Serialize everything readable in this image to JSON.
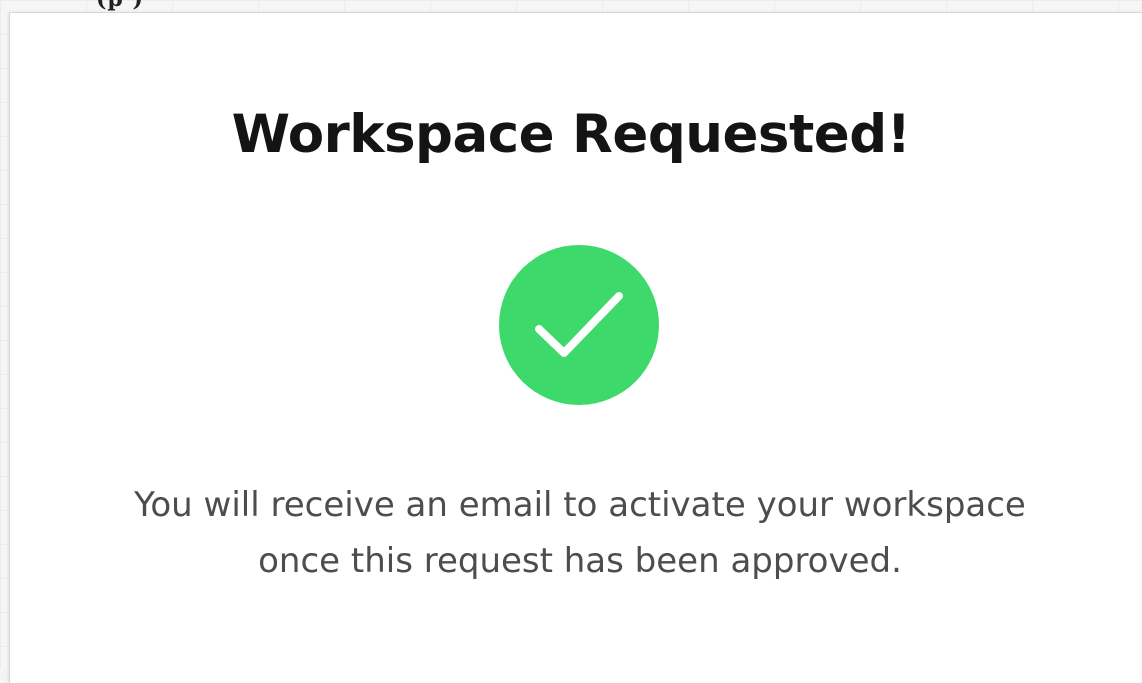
{
  "background": {
    "partial_text": "(p        )"
  },
  "dialog": {
    "title": "Workspace Requested!",
    "icon": "check-circle-icon",
    "icon_color": "#3ed96b",
    "message_line1": "You will receive an email to activate your workspace",
    "message_line2": "once this request has been approved."
  }
}
